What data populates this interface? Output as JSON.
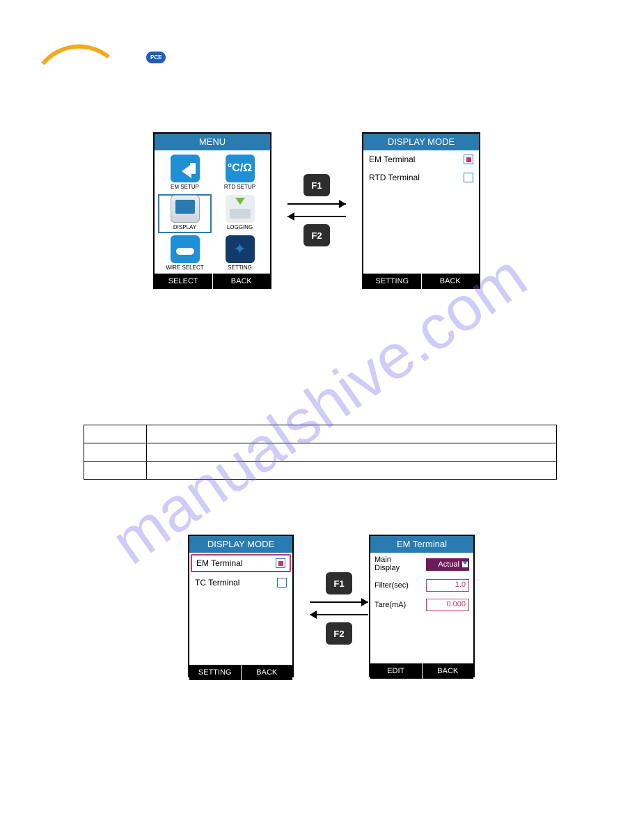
{
  "watermark": "manualshive.com",
  "logo_badge": "PCE",
  "row1": {
    "menu": {
      "title": "MENU",
      "items": [
        {
          "label": "EM SETUP"
        },
        {
          "label": "RTD SETUP",
          "glyph": "°C/Ω"
        },
        {
          "label": "DISPLAY",
          "selected": true
        },
        {
          "label": "LOGGING"
        },
        {
          "label": "WIRE SELECT"
        },
        {
          "label": "SETTING"
        }
      ],
      "footer_left": "SELECT",
      "footer_right": "BACK"
    },
    "display_mode": {
      "title": "DISPLAY MODE",
      "items": [
        {
          "label": "EM Terminal",
          "checked": true
        },
        {
          "label": "RTD Terminal",
          "checked": false
        }
      ],
      "footer_left": "SETTING",
      "footer_right": "BACK"
    },
    "f1": "F1",
    "f2": "F2"
  },
  "table": {
    "c0": "",
    "c1": "",
    "r1c0": "",
    "r1c1": "",
    "r2c0": "",
    "r2c1": ""
  },
  "row2": {
    "display_mode": {
      "title": "DISPLAY MODE",
      "items": [
        {
          "label": "EM Terminal",
          "checked": true,
          "selected": true
        },
        {
          "label": "TC Terminal",
          "checked": false
        }
      ],
      "footer_left": "SETTING",
      "footer_right": "BACK"
    },
    "em_terminal": {
      "title": "EM Terminal",
      "main_display_label": "Main\nDisplay",
      "main_display_value": "Actual",
      "filter_label": "Filter(sec)",
      "filter_value": "1.0",
      "tare_label": "Tare(mA)",
      "tare_value": "0.000",
      "footer_left": "EDIT",
      "footer_right": "BACK"
    },
    "f1": "F1",
    "f2": "F2"
  }
}
